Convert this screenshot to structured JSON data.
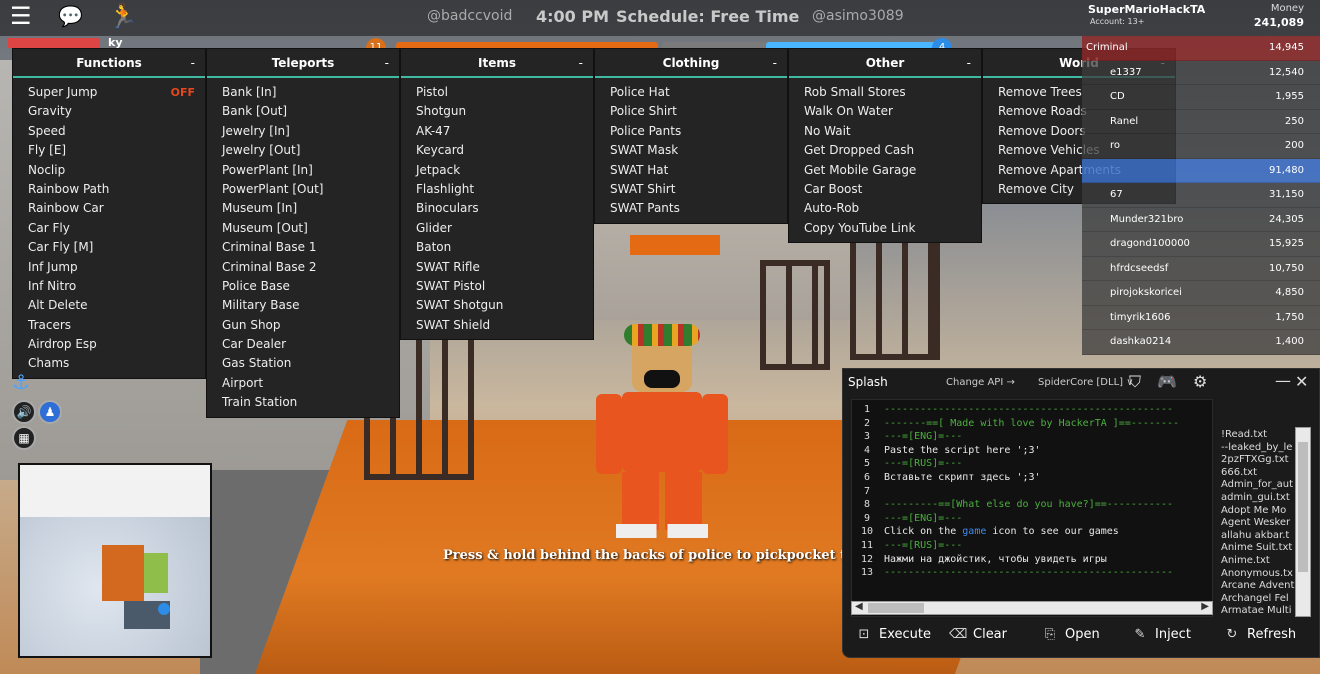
{
  "topbar": {
    "handle_1": "@badccvoid",
    "time": "4:00 PM",
    "schedule": "Schedule: Free Time",
    "handle_2": "@asimo3089",
    "username": "SuperMarioHackTA",
    "account": "Account: 13+",
    "money_label": "Money",
    "money_value": "241,089"
  },
  "hud": {
    "ky_label": "ky",
    "badge_left": "11",
    "badge_right": "4"
  },
  "menus": [
    {
      "title": "Functions",
      "min": "-",
      "items": [
        {
          "label": "Super Jump",
          "state": "OFF"
        },
        {
          "label": "Gravity"
        },
        {
          "label": "Speed"
        },
        {
          "label": "Fly [E]"
        },
        {
          "label": "Noclip"
        },
        {
          "label": "Rainbow Path"
        },
        {
          "label": "Rainbow Car"
        },
        {
          "label": "Car Fly"
        },
        {
          "label": "Car Fly [M]"
        },
        {
          "label": "Inf Jump"
        },
        {
          "label": "Inf Nitro"
        },
        {
          "label": "Alt Delete"
        },
        {
          "label": "Tracers"
        },
        {
          "label": "Airdrop Esp"
        },
        {
          "label": "Chams"
        }
      ]
    },
    {
      "title": "Teleports",
      "min": "-",
      "items": [
        {
          "label": "Bank [In]"
        },
        {
          "label": "Bank [Out]"
        },
        {
          "label": "Jewelry [In]"
        },
        {
          "label": "Jewelry [Out]"
        },
        {
          "label": "PowerPlant [In]"
        },
        {
          "label": "PowerPlant [Out]"
        },
        {
          "label": "Museum [In]"
        },
        {
          "label": "Museum [Out]"
        },
        {
          "label": "Criminal Base 1"
        },
        {
          "label": "Criminal Base 2"
        },
        {
          "label": "Police Base"
        },
        {
          "label": "Military Base"
        },
        {
          "label": "Gun Shop"
        },
        {
          "label": "Car Dealer"
        },
        {
          "label": "Gas Station"
        },
        {
          "label": "Airport"
        },
        {
          "label": "Train Station"
        }
      ]
    },
    {
      "title": "Items",
      "min": "-",
      "items": [
        {
          "label": "Pistol"
        },
        {
          "label": "Shotgun"
        },
        {
          "label": "AK-47"
        },
        {
          "label": "Keycard"
        },
        {
          "label": "Jetpack"
        },
        {
          "label": "Flashlight"
        },
        {
          "label": "Binoculars"
        },
        {
          "label": "Glider"
        },
        {
          "label": "Baton"
        },
        {
          "label": "SWAT Rifle"
        },
        {
          "label": "SWAT Pistol"
        },
        {
          "label": "SWAT Shotgun"
        },
        {
          "label": "SWAT Shield"
        }
      ]
    },
    {
      "title": "Clothing",
      "min": "-",
      "items": [
        {
          "label": "Police Hat"
        },
        {
          "label": "Police Shirt"
        },
        {
          "label": "Police Pants"
        },
        {
          "label": "SWAT Mask"
        },
        {
          "label": "SWAT Hat"
        },
        {
          "label": "SWAT Shirt"
        },
        {
          "label": "SWAT Pants"
        }
      ]
    },
    {
      "title": "Other",
      "min": "-",
      "items": [
        {
          "label": "Rob Small Stores"
        },
        {
          "label": "Walk On Water"
        },
        {
          "label": "No Wait"
        },
        {
          "label": "Get Dropped Cash"
        },
        {
          "label": "Get Mobile Garage"
        },
        {
          "label": "Car Boost"
        },
        {
          "label": "Auto-Rob"
        },
        {
          "label": "Copy YouTube Link"
        }
      ]
    },
    {
      "title": "World",
      "min": "-",
      "items": [
        {
          "label": "Remove Trees"
        },
        {
          "label": "Remove Roads"
        },
        {
          "label": "Remove Doors"
        },
        {
          "label": "Remove Vehicles"
        },
        {
          "label": "Remove Apartments"
        },
        {
          "label": "Remove City"
        }
      ]
    }
  ],
  "leaderboard": [
    {
      "name": "Criminal",
      "value": "14,945",
      "kind": "criminal"
    },
    {
      "name": "e1337",
      "value": "12,540"
    },
    {
      "name": "CD",
      "value": "1,955"
    },
    {
      "name": "Ranel",
      "value": "250"
    },
    {
      "name": "ro",
      "value": "200"
    },
    {
      "name": "",
      "value": "91,480",
      "kind": "police"
    },
    {
      "name": "67",
      "value": "31,150"
    },
    {
      "name": "Munder321bro",
      "value": "24,305"
    },
    {
      "name": "dragond100000",
      "value": "15,925"
    },
    {
      "name": "hfrdcseedsf",
      "value": "10,750"
    },
    {
      "name": "pirojokskoricei",
      "value": "4,850"
    },
    {
      "name": "timyrik1606",
      "value": "1,750"
    },
    {
      "name": "dashka0214",
      "value": "1,400"
    }
  ],
  "hint": "Press & hold behind the backs of police to pickpocket their key",
  "splash": {
    "title": "Splash",
    "change_api": "Change API →",
    "dll": "SpiderCore [DLL] ∨",
    "line_numbers": [
      "1",
      "2",
      "3",
      "4",
      "5",
      "6",
      "7",
      "8",
      "9",
      "10",
      "11",
      "12",
      "13"
    ],
    "lines": [
      {
        "text": "------------------------------------------------",
        "green": true
      },
      {
        "text": "-------==[ Made with love by HackerTA ]==--------",
        "green": true
      },
      {
        "text": "---=[ENG]=---",
        "green": true
      },
      {
        "text": "Paste the script here ';3'",
        "green": false
      },
      {
        "text": "---=[RUS]=---",
        "green": true
      },
      {
        "text": "Вставьте скрипт здесь ';3'",
        "green": false
      },
      {
        "text": "",
        "green": false
      },
      {
        "text": "---------==[What else do you have?]==-----------",
        "green": true
      },
      {
        "text": "---=[ENG]=---",
        "green": true
      },
      {
        "text": "Click on the ",
        "kw": "game",
        "after": " icon to see our games",
        "green": false
      },
      {
        "text": "---=[RUS]=---",
        "green": true
      },
      {
        "text": "Нажми на джойстик, чтобы увидеть игры",
        "green": false
      },
      {
        "text": "------------------------------------------------",
        "green": true
      }
    ],
    "files": [
      "!Read.txt",
      "--leaked_by_le",
      "2pzFTXGg.txt",
      "666.txt",
      "Admin_for_aut",
      "admin_gui.txt",
      "Adopt Me Mo",
      "Agent Wesker",
      "allahu akbar.t",
      "Anime Suit.txt",
      "Anime.txt",
      "Anonymous.tx",
      "Arcane Advent",
      "Archangel Fel",
      "Armatae Multi"
    ],
    "buttons": {
      "execute": "Execute",
      "clear": "Clear",
      "open": "Open",
      "inject": "Inject",
      "refresh": "Refresh"
    }
  }
}
